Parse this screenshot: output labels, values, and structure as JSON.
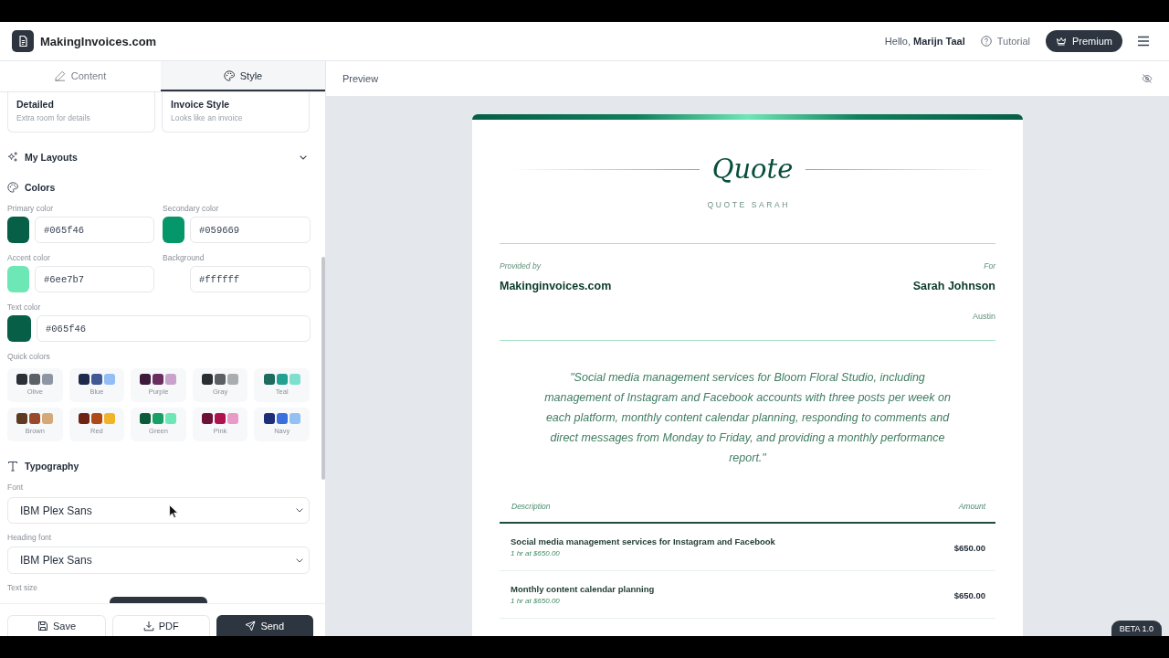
{
  "header": {
    "brand": "MakingInvoices.com",
    "greeting": "Hello, **Marijn Taal**",
    "tutorial": "Tutorial",
    "premium": "Premium"
  },
  "editor": {
    "tabs": [
      {
        "label": "Content",
        "selected": false
      },
      {
        "label": "Style",
        "selected": true
      }
    ],
    "layouts": [
      {
        "title": "Detailed",
        "subtitle": "Extra room for details"
      },
      {
        "title": "Invoice Style",
        "subtitle": "Looks like an invoice"
      }
    ],
    "my_layouts": {
      "title": "My Layouts",
      "expanded": false
    },
    "colors": {
      "title": "Colors",
      "fields": [
        {
          "label": "Primary color",
          "value": "#065f46",
          "color": "#065f46"
        },
        {
          "label": "Secondary color",
          "value": "#059669",
          "color": "#059669"
        },
        {
          "label": "Accent color",
          "value": "#6ee7b7",
          "color": "#6ee7b7"
        },
        {
          "label": "Background",
          "value": "#ffffff"
        },
        {
          "label": "Text color",
          "value": "#065f46",
          "color": "#065f46"
        }
      ],
      "quick_label": "Quick colors",
      "quick_colors": [
        {
          "label": "Olive",
          "swatches": [
            {
              "color": "#2b3038"
            },
            {
              "color": "#5a5f68"
            },
            {
              "color": "#8e96a3"
            }
          ]
        },
        {
          "label": "Blue",
          "swatches": [
            {
              "color": "#1e2a4a"
            },
            {
              "color": "#3d5a94"
            },
            {
              "color": "#93bdf5"
            }
          ]
        },
        {
          "label": "Purple",
          "swatches": [
            {
              "color": "#3d1a3a"
            },
            {
              "color": "#6b2d60"
            },
            {
              "color": "#c9a2cc"
            }
          ]
        },
        {
          "label": "Gray",
          "swatches": [
            {
              "color": "#2b2e31"
            },
            {
              "color": "#5c6063"
            },
            {
              "color": "#a9adb0"
            }
          ]
        },
        {
          "label": "Teal",
          "swatches": [
            {
              "color": "#1c6b5e"
            },
            {
              "color": "#21a192"
            },
            {
              "color": "#7de0cc"
            }
          ]
        },
        {
          "label": "Brown",
          "swatches": [
            {
              "color": "#5e3a22"
            },
            {
              "color": "#9a4a2a"
            },
            {
              "color": "#d4a97a"
            }
          ]
        },
        {
          "label": "Red",
          "swatches": [
            {
              "color": "#6e2412"
            },
            {
              "color": "#b04a14"
            },
            {
              "color": "#f0b429"
            }
          ]
        },
        {
          "label": "Green",
          "swatches": [
            {
              "color": "#0b5a3a"
            },
            {
              "color": "#17a065"
            },
            {
              "color": "#6ee7b7"
            }
          ]
        },
        {
          "label": "Pink",
          "swatches": [
            {
              "color": "#6e1035"
            },
            {
              "color": "#b0124e"
            },
            {
              "color": "#e89ac8"
            }
          ]
        },
        {
          "label": "Navy",
          "swatches": [
            {
              "color": "#1e2d78"
            },
            {
              "color": "#3a6fdd"
            },
            {
              "color": "#93c1f5"
            }
          ]
        }
      ]
    },
    "typography": {
      "title": "Typography",
      "fields": [
        {
          "label": "Font",
          "value": "IBM Plex Sans"
        },
        {
          "label": "Heading font",
          "value": "IBM Plex Sans"
        }
      ],
      "text_size_label": "Text size"
    },
    "actions": [
      {
        "label": "Save",
        "primary": false
      },
      {
        "label": "PDF",
        "primary": false
      },
      {
        "label": "Send",
        "primary": true
      }
    ]
  },
  "preview": {
    "title": "Preview",
    "document": {
      "heading": "Quote",
      "reference": "QUOTE SARAH",
      "from": {
        "label": "Provided by",
        "name": "Makinginvoices.com"
      },
      "to": {
        "label": "For",
        "name": "Sarah Johnson",
        "city": "Austin"
      },
      "summary": "\"Social media management services for Bloom Floral Studio, including management of Instagram and Facebook accounts with three posts per week on each platform, monthly content calendar planning, responding to comments and direct messages from Monday to Friday, and providing a monthly performance report.\"",
      "table": {
        "columns": [
          "Description",
          "Amount"
        ],
        "rows": [
          {
            "description": "Social media management services for Instagram and Facebook",
            "detail": "1 hr at $650.00",
            "amount": "$650.00"
          },
          {
            "description": "Monthly content calendar planning",
            "detail": "1 hr at $650.00",
            "amount": "$650.00"
          }
        ]
      }
    }
  },
  "badge": "BETA 1.0"
}
